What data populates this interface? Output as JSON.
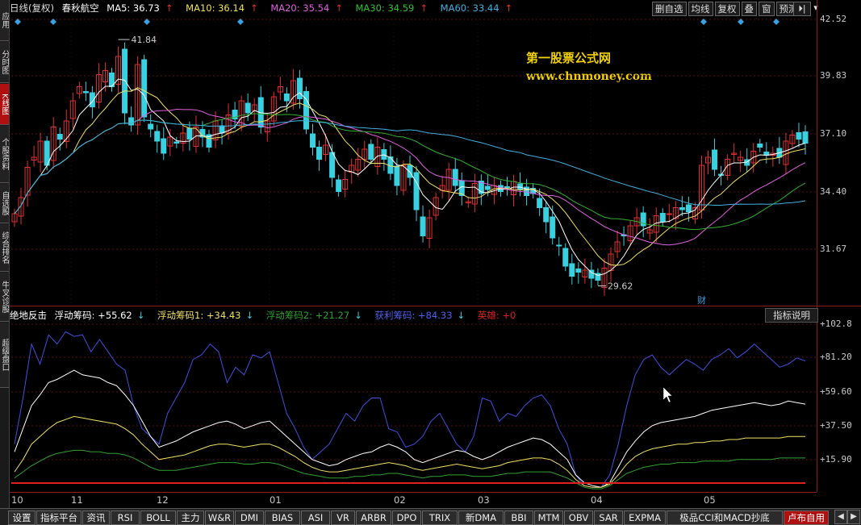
{
  "left_tabs": [
    {
      "label": "应用",
      "active": false
    },
    {
      "label": "分时图",
      "active": false
    },
    {
      "label": "K线图",
      "active": true
    },
    {
      "label": "个股资料",
      "active": false
    },
    {
      "label": "自选股",
      "active": false
    },
    {
      "label": "综合排名",
      "active": false
    },
    {
      "label": "牛叉诊股",
      "active": false
    },
    {
      "label": "超级盘口",
      "active": false
    }
  ],
  "header": {
    "period": "日线(复权)",
    "stock_name": "春秋航空",
    "ma5": "MA5: 36.73",
    "ma10": "MA10: 36.14",
    "ma20": "MA20: 35.54",
    "ma30": "MA30: 34.59",
    "ma60": "MA60: 33.44",
    "up_arrow": "↑"
  },
  "toolbar": {
    "buttons": [
      "删自选",
      "均线",
      "复权",
      "叠",
      "窗",
      "预测"
    ],
    "extra_icon": "⏵|",
    "dropdown_icon": "▾"
  },
  "colors": {
    "up": "#e03030",
    "down": "#39d0e0",
    "ma5": "#ffffff",
    "ma10": "#f0e060",
    "ma20": "#e060e0",
    "ma30": "#30b030",
    "ma60": "#40b0e0",
    "float_chip": "#ffffff",
    "float_chip1": "#f0e060",
    "float_chip2": "#30a030",
    "profit_chip": "#4050e0",
    "hero": "#e02020"
  },
  "watermark": {
    "line1": "第一股票公式网",
    "line2": "www.chnmoney.com"
  },
  "price_axis": [
    "42.52",
    "39.83",
    "37.10",
    "34.40",
    "31.67"
  ],
  "annotations": {
    "high": "41.84",
    "low": "29.62",
    "finance_marker": "财"
  },
  "indicator": {
    "name": "绝地反击",
    "float_chip": "浮动筹码: +55.62",
    "float_chip1": "浮动筹码1: +34.43",
    "float_chip2": "浮动筹码2: +21.27",
    "profit_chip": "获利筹码: +84.33",
    "hero": "英雄: +0",
    "down_arrow": "↓",
    "explain_button": "指标说明",
    "axis": [
      "+102.8",
      "+81.20",
      "+59.60",
      "+37.50",
      "+15.90"
    ]
  },
  "x_axis": [
    "10",
    "11",
    "12",
    "01",
    "02",
    "03",
    "04",
    "05"
  ],
  "bottom_tabs": [
    "设置",
    "指标平台",
    "资讯",
    "RSI",
    "BOLL",
    "主力",
    "W&R",
    "DMI",
    "BIAS",
    "ASI",
    "VR",
    "ARBR",
    "DPO",
    "TRIX",
    "新DMA",
    "BBI",
    "MTM",
    "OBV",
    "SAR",
    "EXPMA",
    "极品CCI和MACD抄底",
    "卢布自用"
  ],
  "bottom_active": "卢布自用",
  "chart_data": [
    {
      "type": "candlestick",
      "title": "春秋航空 日线(复权)",
      "ylim": [
        29.0,
        43.0
      ],
      "y_ticks": [
        42.52,
        39.83,
        37.1,
        34.4,
        31.67
      ],
      "x_months": [
        "10",
        "11",
        "12",
        "01",
        "02",
        "03",
        "04",
        "05"
      ],
      "close_series": [
        33.2,
        34.0,
        35.5,
        36.0,
        36.8,
        35.6,
        37.5,
        36.9,
        37.8,
        38.8,
        39.5,
        39.2,
        38.5,
        40.1,
        40.3,
        39.5,
        41.0,
        38.2,
        37.6,
        40.6,
        38.0,
        37.4,
        36.8,
        36.2,
        37.0,
        36.7,
        37.2,
        36.9,
        37.5,
        37.0,
        36.5,
        37.8,
        37.2,
        38.1,
        37.9,
        38.8,
        38.2,
        38.6,
        37.5,
        37.8,
        39.0,
        39.5,
        38.8,
        39.8,
        38.9,
        37.4,
        36.5,
        35.9,
        36.6,
        35.0,
        34.3,
        34.9,
        35.6,
        35.9,
        36.4,
        35.9,
        36.5,
        35.9,
        35.2,
        34.6,
        35.6,
        35.0,
        33.4,
        32.1,
        33.0,
        34.0,
        34.6,
        35.4,
        34.6,
        34.1,
        33.8,
        34.7,
        34.2,
        34.4,
        34.6,
        34.3,
        34.5,
        34.8,
        34.4,
        34.1,
        34.2,
        33.5,
        32.8,
        32.0,
        31.6,
        30.6,
        30.1,
        30.3,
        30.4,
        30.0,
        29.9,
        30.5,
        31.2,
        31.8,
        32.1,
        32.6,
        33.0,
        32.6,
        32.4,
        33.1,
        32.8,
        33.2,
        33.5,
        33.4,
        33.3,
        33.5,
        35.6,
        36.0,
        35.4,
        35.1,
        35.9,
        36.2,
        36.0,
        35.6,
        36.3,
        36.5,
        36.1,
        36.2,
        36.0,
        36.8,
        37.1,
        36.9,
        36.7
      ],
      "ma_lines": [
        {
          "name": "MA5",
          "value_last": 36.73
        },
        {
          "name": "MA10",
          "value_last": 36.14
        },
        {
          "name": "MA20",
          "value_last": 35.54
        },
        {
          "name": "MA30",
          "value_last": 34.59
        },
        {
          "name": "MA60",
          "value_last": 33.44
        }
      ],
      "high_mark": 41.84,
      "low_mark": 29.62
    },
    {
      "type": "line",
      "title": "绝地反击",
      "ylim": [
        0,
        110
      ],
      "y_ticks": [
        102.8,
        81.2,
        59.6,
        37.5,
        15.9
      ],
      "series": [
        {
          "name": "获利筹码",
          "last": 84.33,
          "values": [
            30,
            60,
            95,
            82,
            101,
            95,
            103,
            100,
            101,
            90,
            98,
            90,
            82,
            78,
            55,
            40,
            35,
            30,
            50,
            60,
            70,
            85,
            88,
            95,
            90,
            70,
            80,
            75,
            88,
            86,
            90,
            70,
            50,
            40,
            28,
            20,
            25,
            30,
            40,
            50,
            45,
            55,
            60,
            60,
            40,
            38,
            28,
            30,
            35,
            45,
            50,
            40,
            30,
            25,
            35,
            60,
            58,
            45,
            50,
            48,
            55,
            60,
            62,
            55,
            40,
            30,
            10,
            3,
            2,
            2,
            10,
            30,
            55,
            75,
            85,
            88,
            80,
            75,
            80,
            85,
            82,
            78,
            85,
            88,
            92,
            86,
            90,
            95,
            90,
            85,
            80,
            82,
            86,
            84
          ]
        },
        {
          "name": "浮动筹码",
          "last": 55.62,
          "values": [
            25,
            40,
            55,
            62,
            70,
            72,
            75,
            78,
            75,
            74,
            73,
            70,
            68,
            62,
            55,
            45,
            35,
            28,
            30,
            32,
            35,
            38,
            40,
            42,
            44,
            45,
            43,
            40,
            42,
            44,
            45,
            40,
            35,
            30,
            25,
            20,
            18,
            16,
            17,
            20,
            22,
            24,
            25,
            28,
            30,
            28,
            25,
            20,
            18,
            20,
            22,
            24,
            26,
            25,
            22,
            20,
            22,
            25,
            28,
            30,
            32,
            34,
            33,
            30,
            25,
            20,
            10,
            5,
            3,
            2,
            5,
            15,
            25,
            32,
            38,
            42,
            44,
            45,
            46,
            47,
            48,
            50,
            52,
            53,
            54,
            55,
            56,
            57,
            56,
            55,
            56,
            58,
            57,
            56
          ]
        },
        {
          "name": "浮动筹码1",
          "last": 34.43,
          "values": [
            12,
            20,
            30,
            35,
            40,
            44,
            46,
            48,
            47,
            46,
            45,
            44,
            43,
            40,
            36,
            30,
            25,
            20,
            21,
            22,
            23,
            25,
            27,
            29,
            30,
            30,
            29,
            28,
            29,
            30,
            30,
            28,
            25,
            22,
            18,
            15,
            13,
            12,
            12,
            13,
            14,
            15,
            16,
            17,
            18,
            17,
            16,
            14,
            13,
            14,
            15,
            16,
            17,
            16,
            15,
            14,
            15,
            16,
            18,
            19,
            20,
            21,
            21,
            20,
            17,
            13,
            7,
            3,
            2,
            2,
            4,
            10,
            17,
            22,
            25,
            27,
            28,
            29,
            30,
            30,
            31,
            31,
            32,
            32,
            33,
            33,
            34,
            34,
            34,
            34,
            34,
            35,
            35,
            35
          ]
        },
        {
          "name": "浮动筹码2",
          "last": 21.27,
          "values": [
            8,
            12,
            16,
            19,
            22,
            24,
            25,
            26,
            26,
            25,
            25,
            24,
            24,
            23,
            21,
            18,
            15,
            13,
            13,
            13,
            14,
            15,
            16,
            17,
            18,
            18,
            18,
            17,
            17,
            18,
            18,
            17,
            15,
            13,
            11,
            10,
            9,
            8,
            8,
            8,
            9,
            9,
            10,
            10,
            11,
            11,
            10,
            9,
            8,
            9,
            9,
            10,
            10,
            10,
            9,
            9,
            9,
            10,
            11,
            11,
            12,
            12,
            12,
            12,
            10,
            8,
            5,
            2,
            1,
            1,
            3,
            7,
            11,
            13,
            15,
            16,
            17,
            17,
            18,
            18,
            18,
            19,
            19,
            19,
            19,
            20,
            20,
            20,
            20,
            20,
            21,
            21,
            21,
            21
          ]
        },
        {
          "name": "英雄",
          "last": 0
        }
      ]
    }
  ]
}
